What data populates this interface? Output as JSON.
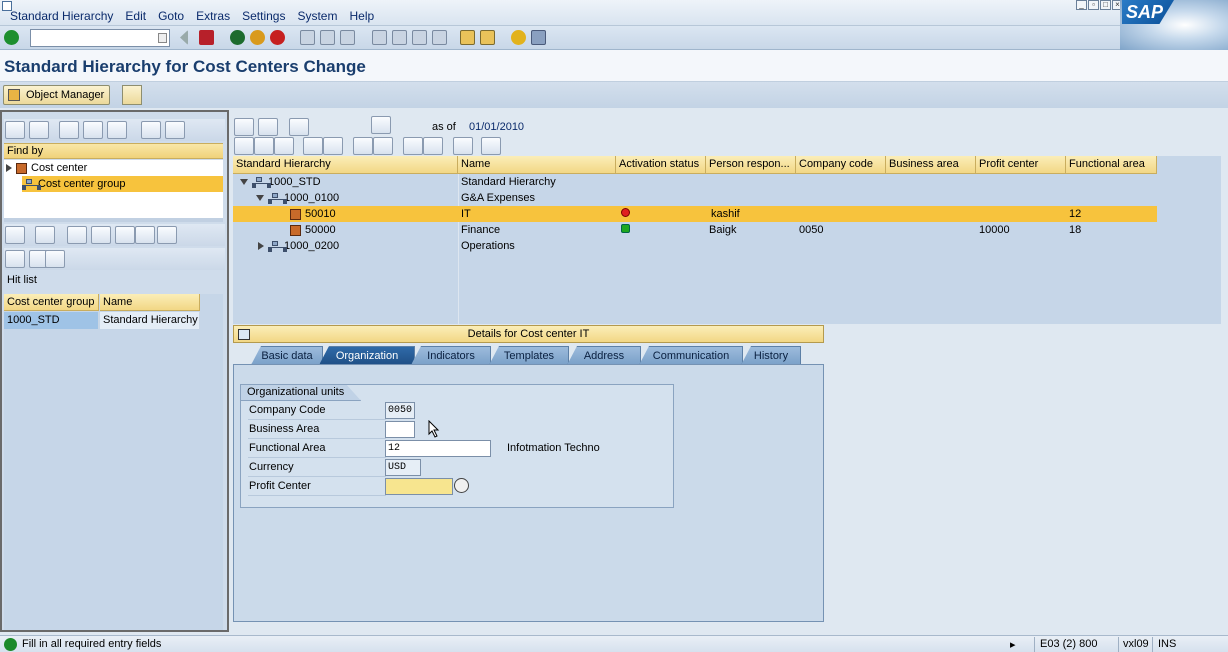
{
  "menu": {
    "items": [
      "Standard Hierarchy",
      "Edit",
      "Goto",
      "Extras",
      "Settings",
      "System",
      "Help"
    ]
  },
  "logo": "SAP",
  "title": "Standard Hierarchy for Cost Centers Change",
  "app_toolbar": {
    "object_manager": "Object Manager"
  },
  "left": {
    "find_by": "Find by",
    "tree": [
      {
        "label": "Cost center",
        "icon": "cost-center-icon"
      },
      {
        "label": "Cost center group",
        "icon": "hierarchy-icon",
        "selected": true
      }
    ],
    "hit_list_label": "Hit list",
    "hit_list": {
      "headers": [
        "Cost center group",
        "Name"
      ],
      "rows": [
        {
          "group": "1000_STD",
          "name": "Standard Hierarchy"
        }
      ]
    }
  },
  "main": {
    "as_of_label": "as of",
    "as_of_date": "01/01/2010",
    "columns": [
      "Standard Hierarchy",
      "Name",
      "Activation status",
      "Person respon...",
      "Company code",
      "Business area",
      "Profit center",
      "Functional area"
    ],
    "rows": [
      {
        "node": "1000_STD",
        "name": "Standard Hierarchy",
        "status": "",
        "person": "",
        "company": "",
        "business": "",
        "profit": "",
        "functional": ""
      },
      {
        "node": "1000_0100",
        "name": "G&A Expenses",
        "status": "",
        "person": "",
        "company": "",
        "business": "",
        "profit": "",
        "functional": ""
      },
      {
        "node": "50010",
        "name": "IT",
        "status": "red",
        "person": "kashif",
        "company": "",
        "business": "",
        "profit": "",
        "functional": "12"
      },
      {
        "node": "50000",
        "name": "Finance",
        "status": "green",
        "person": "Baigk",
        "company": "0050",
        "business": "",
        "profit": "10000",
        "functional": "18"
      },
      {
        "node": "1000_0200",
        "name": "Operations",
        "status": "",
        "person": "",
        "company": "",
        "business": "",
        "profit": "",
        "functional": ""
      }
    ]
  },
  "details": {
    "header": "Details for Cost center IT",
    "tabs": [
      "Basic data",
      "Organization",
      "Indicators",
      "Templates",
      "Address",
      "Communication",
      "History"
    ],
    "active_tab": "Organization",
    "group_title": "Organizational units",
    "fields": [
      {
        "label": "Company Code",
        "value": "0050"
      },
      {
        "label": "Business Area",
        "value": ""
      },
      {
        "label": "Functional Area",
        "value": "12",
        "description": "Infotmation Techno"
      },
      {
        "label": "Currency",
        "value": "USD"
      },
      {
        "label": "Profit Center",
        "value": ""
      }
    ]
  },
  "status_bar": {
    "message": "Fill in all required entry fields",
    "session": "E03 (2) 800",
    "server": "vxl09",
    "mode": "INS"
  }
}
